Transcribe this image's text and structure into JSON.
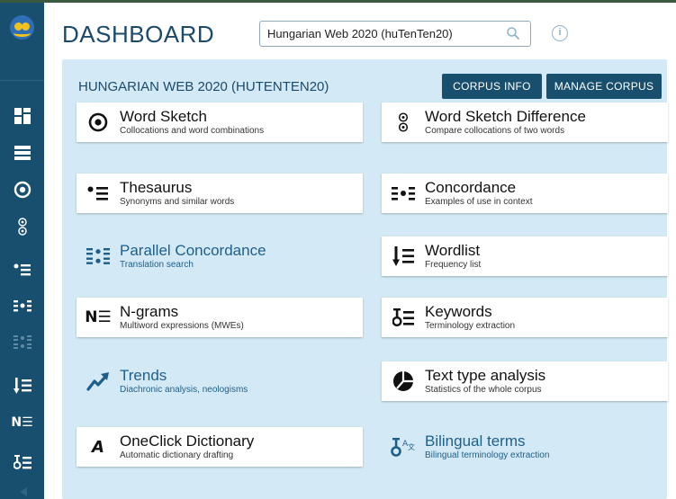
{
  "header": {
    "title": "DASHBOARD",
    "search_value": "Hungarian Web 2020 (huTenTen20)"
  },
  "panel": {
    "title": "HUNGARIAN WEB 2020 (HUTENTEN20)",
    "corpus_info_label": "CORPUS INFO",
    "manage_corpus_label": "MANAGE CORPUS"
  },
  "tools": [
    {
      "name": "Word Sketch",
      "desc": "Collocations and word combinations"
    },
    {
      "name": "Word Sketch Difference",
      "desc": "Compare collocations of two words"
    },
    {
      "name": "Thesaurus",
      "desc": "Synonyms and similar words"
    },
    {
      "name": "Concordance",
      "desc": "Examples of use in context"
    },
    {
      "name": "Parallel Concordance",
      "desc": "Translation search"
    },
    {
      "name": "Wordlist",
      "desc": "Frequency list"
    },
    {
      "name": "N-grams",
      "desc": "Multiword expressions (MWEs)"
    },
    {
      "name": "Keywords",
      "desc": "Terminology extraction"
    },
    {
      "name": "Trends",
      "desc": "Diachronic analysis, neologisms"
    },
    {
      "name": "Text type analysis",
      "desc": "Statistics of the whole corpus"
    },
    {
      "name": "OneClick Dictionary",
      "desc": "Automatic dictionary drafting"
    },
    {
      "name": "Bilingual terms",
      "desc": "Bilingual terminology extraction"
    }
  ],
  "icons": {
    "ngrams_glyph": "N☰",
    "oneclick_glyph": "A",
    "bilingual_glyph": "ꝺ"
  },
  "colors": {
    "sidebar": "#194f6e",
    "panel": "#d3eaf6",
    "accent": "#1b4a6b",
    "link": "#1e5f8a"
  }
}
